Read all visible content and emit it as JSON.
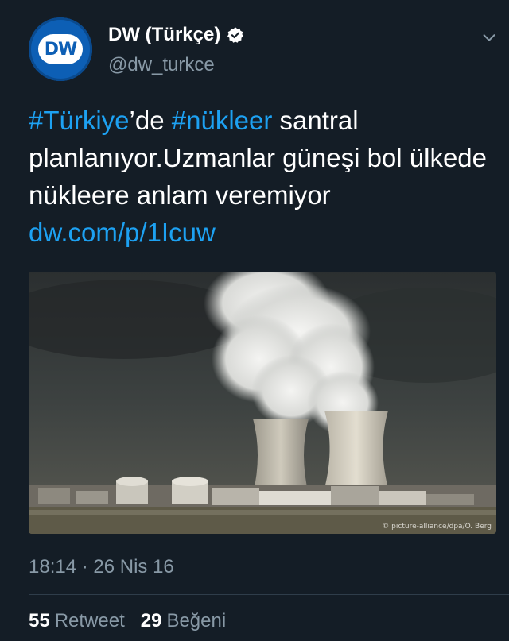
{
  "account": {
    "name": "DW (Türkçe)",
    "handle": "@dw_turkce",
    "avatar_text": "DW"
  },
  "tweet": {
    "hashtag1": "#Türkiye",
    "text1": "’de ",
    "hashtag2": "#nükleer",
    "text2": " santral planlanıyor.Uzmanlar güneşi bol ülkede nükleere anlam veremiyor ",
    "link": "dw.com/p/1Icuw"
  },
  "media": {
    "credit": "© picture-alliance/dpa/O. Berg"
  },
  "timestamp": "18:14 · 26 Nis 16",
  "stats": {
    "retweets": "55",
    "retweets_label": "Retweet",
    "likes": "29",
    "likes_label": "Beğeni"
  },
  "colors": {
    "background": "#141d26",
    "link": "#1da1f2",
    "muted": "#8899a6",
    "brand": "#0d5fb5"
  },
  "icons": [
    "verified-icon",
    "chevron-down-icon"
  ]
}
